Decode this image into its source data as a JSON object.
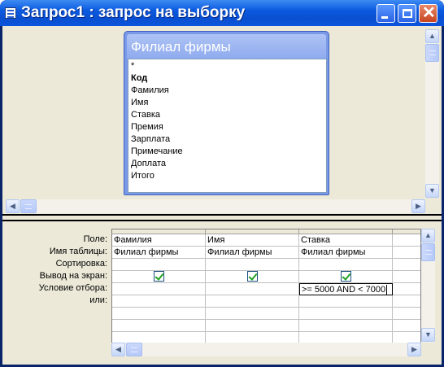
{
  "window": {
    "title": "Запрос1 : запрос на выборку"
  },
  "table_box": {
    "title": "Филиал фирмы",
    "fields": [
      "*",
      "Код",
      "Фамилия",
      "Имя",
      "Ставка",
      "Премия",
      "Зарплата",
      "Примечание",
      "Доплата",
      "Итого"
    ],
    "bold_field": "Код"
  },
  "grid": {
    "row_labels": [
      "Поле:",
      "Имя таблицы:",
      "Сортировка:",
      "Вывод на экран:",
      "Условие отбора:",
      "или:"
    ],
    "columns": [
      {
        "field": "Фамилия",
        "table": "Филиал фирмы",
        "sort": "",
        "show": true,
        "criteria": "",
        "or": ""
      },
      {
        "field": "Имя",
        "table": "Филиал фирмы",
        "sort": "",
        "show": true,
        "criteria": "",
        "or": ""
      },
      {
        "field": "Ставка",
        "table": "Филиал фирмы",
        "sort": "",
        "show": true,
        "criteria": ">= 5000 AND < 7000",
        "or": ""
      },
      {
        "field": "",
        "table": "",
        "sort": "",
        "show": false,
        "criteria": "",
        "or": ""
      }
    ]
  },
  "icons": {
    "app": "query-window-icon",
    "minimize": "minimize-icon",
    "maximize": "maximize-icon",
    "close": "close-icon"
  },
  "colors": {
    "titlebar": "#0b5ae0",
    "table_header": "#8fabef",
    "checkmark": "#21a121"
  }
}
